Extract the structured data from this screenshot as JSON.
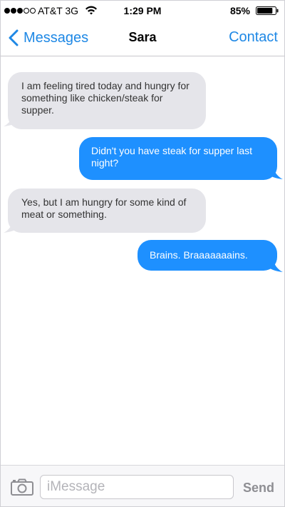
{
  "status_bar": {
    "carrier": "AT&T 3G",
    "time": "1:29 PM",
    "battery": "85%",
    "signal_bars_filled": 3,
    "signal_bars_total": 5,
    "battery_level": 0.85
  },
  "nav": {
    "back_label": "Messages",
    "title": "Sara",
    "contact_label": "Contact",
    "accent_color": "#1e88e5"
  },
  "messages": [
    {
      "direction": "incoming",
      "text": "I am feeling tired today and hungry for something like chicken/steak for supper."
    },
    {
      "direction": "outgoing",
      "text": "Didn't you have steak for supper last night?"
    },
    {
      "direction": "incoming",
      "text": "Yes, but I am hungry for some kind of meat or something."
    },
    {
      "direction": "outgoing",
      "text": "Brains. Braaaaaaains."
    }
  ],
  "input": {
    "placeholder": "iMessage",
    "value": "",
    "send_label": "Send"
  },
  "colors": {
    "incoming_bubble": "#e5e5ea",
    "outgoing_bubble": "#1e90ff"
  },
  "icons": {
    "back": "chevron-left-icon",
    "wifi": "wifi-icon",
    "battery": "battery-icon",
    "camera": "camera-icon"
  }
}
